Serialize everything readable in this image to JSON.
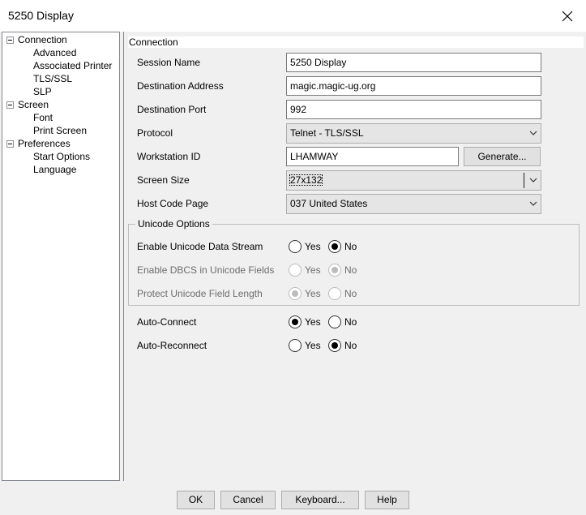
{
  "window": {
    "title": "5250 Display"
  },
  "tree": {
    "items": [
      {
        "label": "Connection",
        "level": 0
      },
      {
        "label": "Advanced",
        "level": 1
      },
      {
        "label": "Associated Printer",
        "level": 1
      },
      {
        "label": "TLS/SSL",
        "level": 1
      },
      {
        "label": "SLP",
        "level": 1
      },
      {
        "label": "Screen",
        "level": 0
      },
      {
        "label": "Font",
        "level": 1
      },
      {
        "label": "Print Screen",
        "level": 1
      },
      {
        "label": "Preferences",
        "level": 0
      },
      {
        "label": "Start Options",
        "level": 1
      },
      {
        "label": "Language",
        "level": 1
      }
    ]
  },
  "panel": {
    "section_title": "Connection",
    "session_name": {
      "label": "Session Name",
      "value": "5250 Display"
    },
    "destination_address": {
      "label": "Destination Address",
      "value": "magic.magic-ug.org"
    },
    "destination_port": {
      "label": "Destination Port",
      "value": "992"
    },
    "protocol": {
      "label": "Protocol",
      "selected": "Telnet - TLS/SSL"
    },
    "workstation_id": {
      "label": "Workstation ID",
      "value": "LHAMWAY",
      "button": "Generate..."
    },
    "screen_size": {
      "label": "Screen Size",
      "selected": "27x132"
    },
    "host_code_page": {
      "label": "Host Code Page",
      "selected": "037 United States"
    }
  },
  "unicode": {
    "title": "Unicode Options",
    "data_stream": {
      "label": "Enable Unicode Data Stream",
      "yes": "Yes",
      "no": "No",
      "selected": "No",
      "enabled": true
    },
    "dbcs": {
      "label": "Enable DBCS in Unicode Fields",
      "yes": "Yes",
      "no": "No",
      "selected": "No",
      "enabled": false
    },
    "protect": {
      "label": "Protect Unicode Field Length",
      "yes": "Yes",
      "no": "No",
      "selected": "Yes",
      "enabled": false
    }
  },
  "auto": {
    "connect": {
      "label": "Auto-Connect",
      "yes": "Yes",
      "no": "No",
      "selected": "Yes"
    },
    "reconnect": {
      "label": "Auto-Reconnect",
      "yes": "Yes",
      "no": "No",
      "selected": "No"
    }
  },
  "buttons": {
    "ok": "OK",
    "cancel": "Cancel",
    "keyboard": "Keyboard...",
    "help": "Help"
  },
  "icons": {
    "close": "close-icon",
    "collapse": "collapse-icon",
    "dropdown": "chevron-down-icon"
  },
  "colors": {
    "window_bg": "#f0f0f0",
    "field_border": "#7a7a7a",
    "disabled_text": "#6d6d6d"
  }
}
